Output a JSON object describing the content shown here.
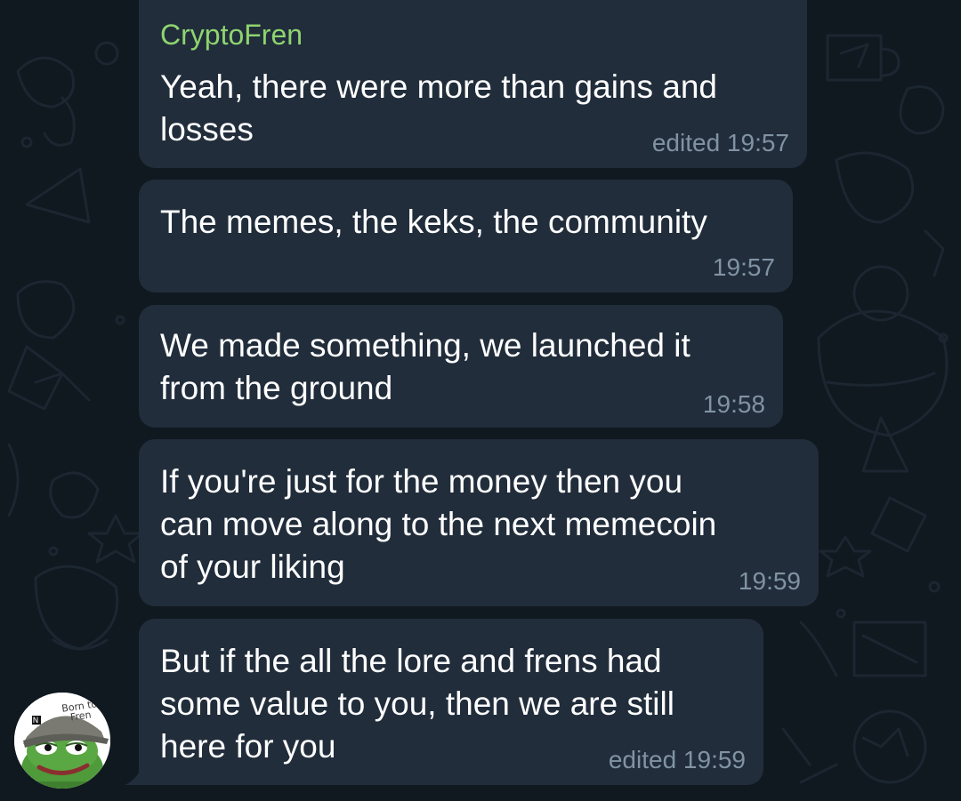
{
  "messages": [
    {
      "sender": "CryptoFren",
      "text": "Yeah, there were more than gains and\nlosses",
      "meta": "edited 19:57"
    },
    {
      "text": "The memes, the keks, the community",
      "meta": "19:57"
    },
    {
      "text": "We made something, we launched it\nfrom the ground",
      "meta": "19:58"
    },
    {
      "text": "If you're just for the money then you\ncan move along to the next memecoin\nof your liking",
      "meta": "19:59"
    },
    {
      "text": "But if the all the lore and frens had\nsome value to you, then we are still\nhere for you",
      "meta": "edited 19:59"
    }
  ],
  "avatar": {
    "caption": "Born to Fren",
    "icon": "pepe-frog-avatar-icon"
  },
  "colors": {
    "background": "#101820",
    "bubble": "#212d3b",
    "sender": "#8ed46f",
    "meta": "#8193a3"
  }
}
